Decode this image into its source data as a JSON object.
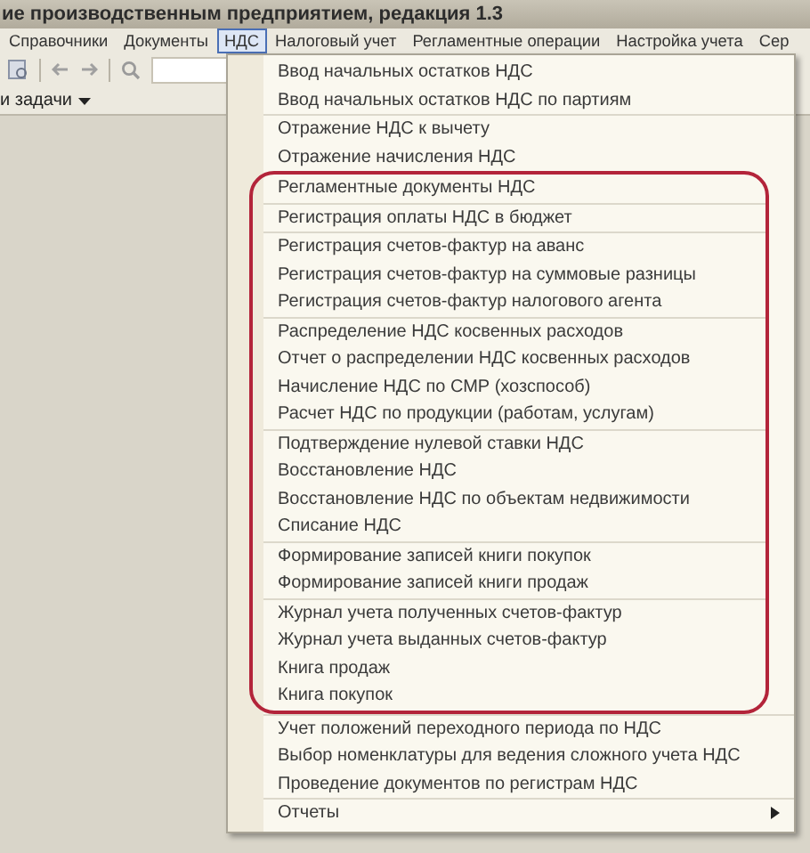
{
  "window": {
    "title": "ие производственным предприятием, редакция 1.3"
  },
  "menu_bar": [
    {
      "label": "Справочники",
      "selected": false
    },
    {
      "label": "Документы",
      "selected": false
    },
    {
      "label": "НДС",
      "selected": true
    },
    {
      "label": "Налоговый учет",
      "selected": false
    },
    {
      "label": "Регламентные операции",
      "selected": false
    },
    {
      "label": "Настройка учета",
      "selected": false
    },
    {
      "label": "Сер",
      "selected": false
    }
  ],
  "task_panel": {
    "label": "и задачи"
  },
  "menu": {
    "groups": [
      {
        "circled": false,
        "items": [
          {
            "label": "Ввод начальных остатков НДС",
            "submenu": false
          },
          {
            "label": "Ввод начальных остатков НДС по партиям",
            "submenu": false
          }
        ]
      },
      {
        "circled": false,
        "items": [
          {
            "label": "Отражение НДС к вычету",
            "submenu": false
          },
          {
            "label": "Отражение начисления НДС",
            "submenu": false
          }
        ]
      },
      {
        "circled": true,
        "items": [
          {
            "label": "Регламентные документы НДС",
            "submenu": false
          }
        ]
      },
      {
        "circled": true,
        "items": [
          {
            "label": "Регистрация оплаты НДС в бюджет",
            "submenu": false
          }
        ]
      },
      {
        "circled": true,
        "items": [
          {
            "label": "Регистрация счетов-фактур на аванс",
            "submenu": false
          },
          {
            "label": "Регистрация счетов-фактур на суммовые разницы",
            "submenu": false
          },
          {
            "label": "Регистрация счетов-фактур налогового агента",
            "submenu": false
          }
        ]
      },
      {
        "circled": true,
        "items": [
          {
            "label": "Распределение НДС косвенных расходов",
            "submenu": false
          },
          {
            "label": "Отчет о распределении НДС косвенных расходов",
            "submenu": false
          },
          {
            "label": "Начисление НДС по СМР (хозспособ)",
            "submenu": false
          },
          {
            "label": "Расчет НДС по продукции (работам, услугам)",
            "submenu": false
          }
        ]
      },
      {
        "circled": true,
        "items": [
          {
            "label": "Подтверждение нулевой ставки НДС",
            "submenu": false
          },
          {
            "label": "Восстановление НДС",
            "submenu": false
          },
          {
            "label": "Восстановление НДС по объектам недвижимости",
            "submenu": false
          },
          {
            "label": "Списание НДС",
            "submenu": false
          }
        ]
      },
      {
        "circled": true,
        "items": [
          {
            "label": "Формирование записей книги покупок",
            "submenu": false
          },
          {
            "label": "Формирование записей книги продаж",
            "submenu": false
          }
        ]
      },
      {
        "circled": true,
        "items": [
          {
            "label": "Журнал учета полученных счетов-фактур",
            "submenu": false
          },
          {
            "label": "Журнал учета выданных счетов-фактур",
            "submenu": false
          },
          {
            "label": "Книга продаж",
            "submenu": false
          },
          {
            "label": "Книга покупок",
            "submenu": false
          }
        ]
      },
      {
        "circled": false,
        "items": [
          {
            "label": "Учет положений переходного периода по НДС",
            "submenu": false
          },
          {
            "label": "Выбор номенклатуры для ведения сложного учета НДС",
            "submenu": false
          },
          {
            "label": "Проведение документов по регистрам НДС",
            "submenu": false
          }
        ]
      },
      {
        "circled": false,
        "items": [
          {
            "label": "Отчеты",
            "submenu": true
          }
        ]
      }
    ]
  }
}
